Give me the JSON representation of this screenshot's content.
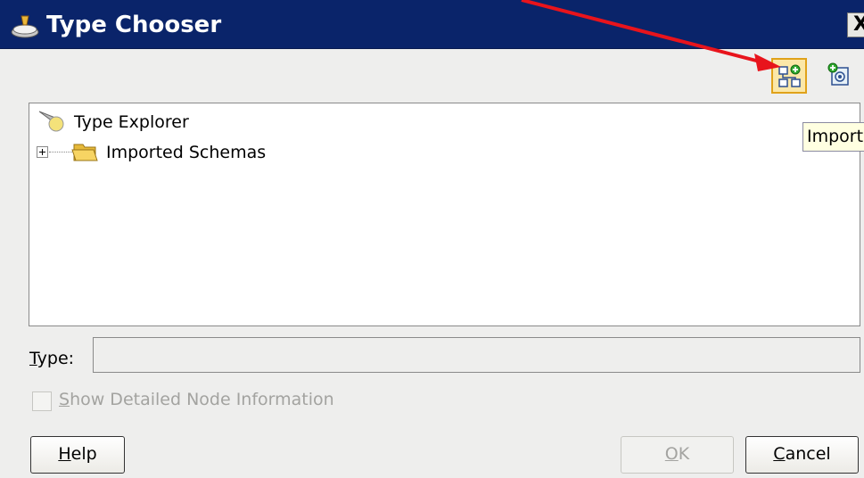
{
  "window": {
    "title": "Type Chooser",
    "close_glyph": "X"
  },
  "toolbar": {
    "import_icon": "import-schema-icon",
    "refresh_icon": "browse-icon"
  },
  "tree": {
    "root_label": "Type Explorer",
    "children": [
      {
        "label": "Imported Schemas",
        "expanded": false
      }
    ]
  },
  "tooltip": {
    "text": "Import"
  },
  "type_field": {
    "label_prefix": "",
    "label_mnemonic": "T",
    "label_rest": "ype:",
    "value": ""
  },
  "checkbox": {
    "label_mnemonic": "S",
    "label_rest": "how Detailed Node Information",
    "checked": false,
    "enabled": false
  },
  "buttons": {
    "help_mnemonic": "H",
    "help_rest": "elp",
    "ok_mnemonic": "O",
    "ok_rest": "K",
    "cancel_mnemonic": "C",
    "cancel_rest": "ancel"
  },
  "colors": {
    "titlebar": "#0a246a",
    "annotation_arrow": "#e8141c",
    "tooltip_bg": "#ffffe1"
  }
}
